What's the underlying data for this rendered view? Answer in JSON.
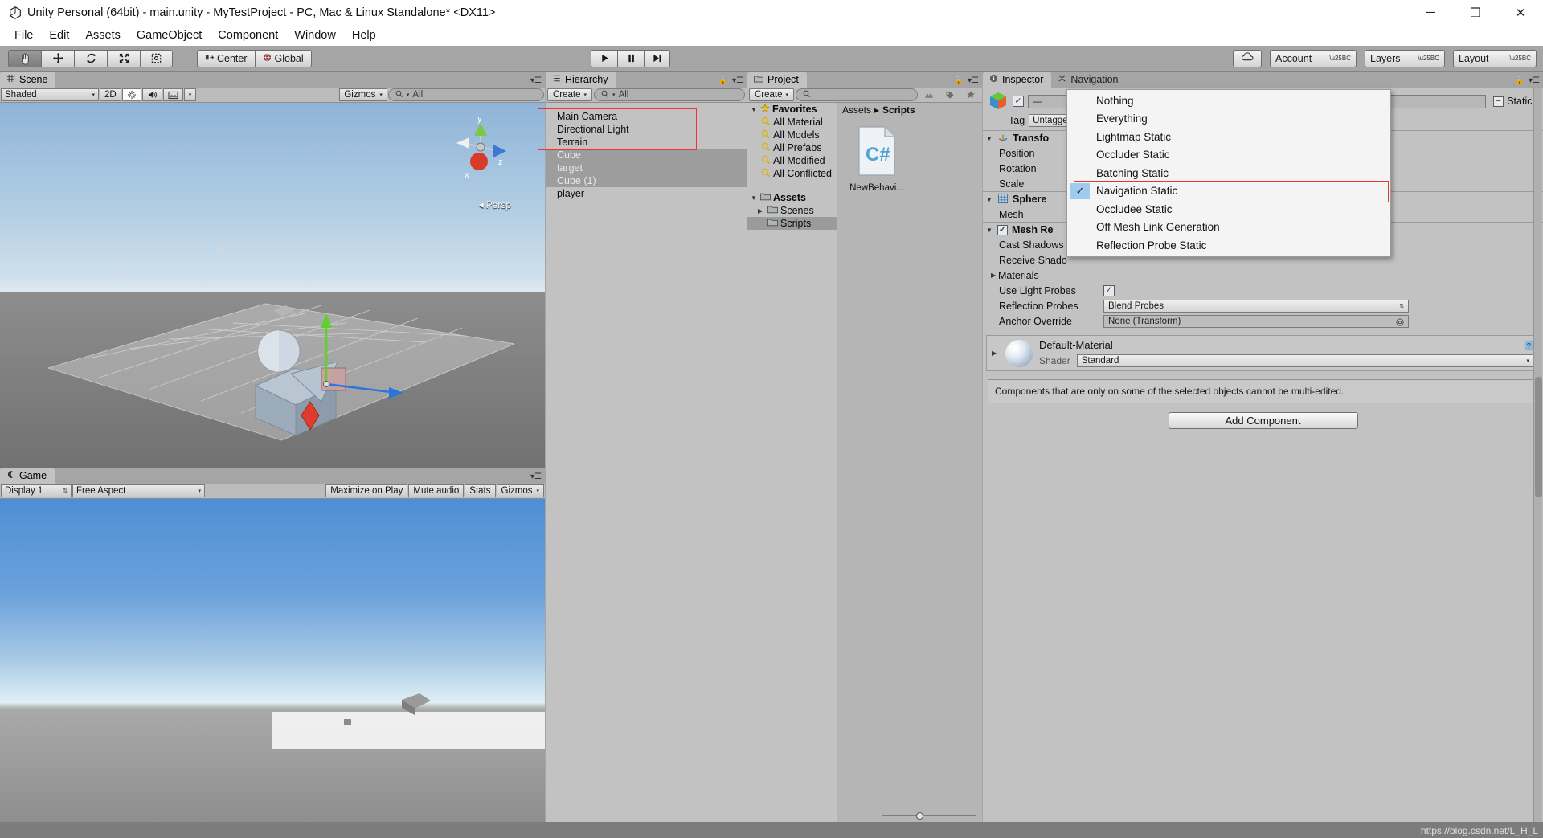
{
  "window": {
    "title": "Unity Personal (64bit) - main.unity - MyTestProject - PC, Mac & Linux Standalone* <DX11>",
    "minimize": "─",
    "maximize": "❐",
    "close": "✕"
  },
  "menubar": {
    "items": [
      "File",
      "Edit",
      "Assets",
      "GameObject",
      "Component",
      "Window",
      "Help"
    ]
  },
  "toolbar": {
    "tools": [
      {
        "name": "hand-tool",
        "glyph": "✋"
      },
      {
        "name": "move-tool",
        "glyph": "✥"
      },
      {
        "name": "rotate-tool",
        "glyph": "↻"
      },
      {
        "name": "scale-tool",
        "glyph": "⤡"
      },
      {
        "name": "rect-tool",
        "glyph": "▣"
      }
    ],
    "pivot_mode": "Center",
    "pivot_rotation": "Global",
    "play": "▶",
    "pause": "❙❙",
    "step": "▶❘",
    "cloud": "☁",
    "account": "Account",
    "layers": "Layers",
    "layout": "Layout"
  },
  "scene": {
    "tab": "Scene",
    "shading_mode": "Shaded",
    "mode_2d": "2D",
    "gizmos": "Gizmos",
    "search_placeholder": "All",
    "persp_label": "Persp",
    "axis_labels": {
      "x": "x",
      "y": "y",
      "z": "z"
    }
  },
  "game": {
    "tab": "Game",
    "display": "Display 1",
    "aspect": "Free Aspect",
    "maximize_on_play": "Maximize on Play",
    "mute_audio": "Mute audio",
    "stats": "Stats",
    "gizmos": "Gizmos"
  },
  "hierarchy": {
    "tab": "Hierarchy",
    "create": "Create",
    "search_placeholder": "All",
    "items": [
      {
        "label": "Main Camera",
        "selected": false
      },
      {
        "label": "Directional Light",
        "selected": false
      },
      {
        "label": "Terrain",
        "selected": false
      },
      {
        "label": "Cube",
        "selected": true
      },
      {
        "label": "target",
        "selected": true
      },
      {
        "label": "Cube (1)",
        "selected": true
      },
      {
        "label": "player",
        "selected": false
      }
    ]
  },
  "project": {
    "tab": "Project",
    "create": "Create",
    "search_placeholder": "",
    "favorites_label": "Favorites",
    "favorites": [
      "All Material",
      "All Models",
      "All Prefabs",
      "All Modified",
      "All Conflicted"
    ],
    "assets_label": "Assets",
    "folders": [
      {
        "label": "Scenes",
        "selected": false
      },
      {
        "label": "Scripts",
        "selected": true
      }
    ],
    "breadcrumb": [
      "Assets",
      "Scripts"
    ],
    "assets": [
      {
        "label": "NewBehavi...",
        "type": "csharp-script",
        "glyph": "C#"
      }
    ]
  },
  "inspector": {
    "tab": "Inspector",
    "nav_tab": "Navigation",
    "object_name": "—",
    "static_label": "Static",
    "tag_label": "Tag",
    "tag_value": "Untagge",
    "components": [
      {
        "name": "Transfo",
        "properties": [
          "Position",
          "Rotation",
          "Scale"
        ]
      },
      {
        "name": "Sphere",
        "properties": [
          "Mesh"
        ]
      },
      {
        "name": "Mesh Re",
        "properties": [
          "Cast Shadows",
          "Receive Shado",
          "Materials"
        ]
      }
    ],
    "use_light_probes": "Use Light Probes",
    "reflection_probes_label": "Reflection Probes",
    "reflection_probes_value": "Blend Probes",
    "anchor_override_label": "Anchor Override",
    "anchor_override_value": "None (Transform)",
    "material_name": "Default-Material",
    "shader_label": "Shader",
    "shader_value": "Standard",
    "warning": "Components that are only on some of the selected objects cannot be multi-edited.",
    "add_component": "Add Component"
  },
  "static_menu": {
    "items": [
      {
        "label": "Nothing",
        "checked": false,
        "highlighted": false
      },
      {
        "label": "Everything",
        "checked": false,
        "highlighted": false
      },
      {
        "label": "Lightmap Static",
        "checked": false,
        "highlighted": false
      },
      {
        "label": "Occluder Static",
        "checked": false,
        "highlighted": false
      },
      {
        "label": "Batching Static",
        "checked": false,
        "highlighted": false
      },
      {
        "label": "Navigation Static",
        "checked": true,
        "highlighted": true
      },
      {
        "label": "Occludee Static",
        "checked": false,
        "highlighted": false
      },
      {
        "label": "Off Mesh Link Generation",
        "checked": false,
        "highlighted": false
      },
      {
        "label": "Reflection Probe Static",
        "checked": false,
        "highlighted": false
      }
    ],
    "check_glyph": "✓"
  },
  "footer": {
    "url": "https://blog.csdn.net/L_H_L"
  },
  "colors": {
    "accent_red": "#ee3333",
    "panel_bg": "#c2c2c2",
    "chrome_bg": "#a5a5a5",
    "highlight_blue": "#9fcbee"
  }
}
